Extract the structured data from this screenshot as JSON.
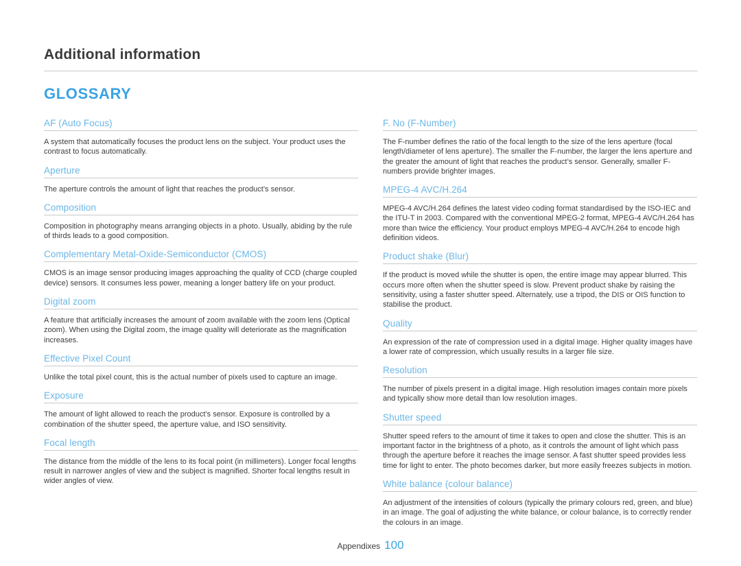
{
  "header": {
    "title": "Additional information"
  },
  "section": {
    "title": "GLOSSARY",
    "accent_color": "#3aa3e3",
    "term_color": "#6ab6e6",
    "rule_color": "#c9c9cb"
  },
  "left_column": [
    {
      "term": "AF (Auto Focus)",
      "desc": "A system that automatically focuses the product lens on the subject. Your product uses the contrast to focus automatically."
    },
    {
      "term": "Aperture",
      "desc": "The aperture controls the amount of light that reaches the product’s sensor."
    },
    {
      "term": "Composition",
      "desc": "Composition in photography means arranging objects in a photo. Usually, abiding by the rule of thirds leads to a good composition."
    },
    {
      "term": "Complementary Metal-Oxide-Semiconductor (CMOS)",
      "desc": "CMOS is an image sensor producing images approaching the quality of CCD (charge coupled device) sensors. It consumes less power, meaning a longer battery life on your product."
    },
    {
      "term": "Digital zoom",
      "desc": "A feature that artificially increases the amount of zoom available with the zoom lens (Optical zoom). When using the Digital zoom, the image quality will deteriorate as the magnification increases."
    },
    {
      "term": "Effective Pixel Count",
      "desc": "Unlike the total pixel count, this is the actual number of pixels used to capture an image."
    },
    {
      "term": "Exposure",
      "desc": "The amount of light allowed to reach the product’s sensor. Exposure is controlled by a combination of the shutter speed, the aperture value, and ISO sensitivity."
    },
    {
      "term": "Focal length",
      "desc": "The distance from the middle of the lens to its focal point (in millimeters). Longer focal lengths result in narrower angles of view and the subject is magnified. Shorter focal lengths result in wider angles of view."
    }
  ],
  "right_column": [
    {
      "term": "F. No (F-Number)",
      "desc": "The F-number defines the ratio of the focal length to the size of the lens aperture (focal length/diameter of lens aperture). The smaller the F-number, the larger the lens aperture and the greater the amount of light that reaches the product’s sensor. Generally, smaller F-numbers provide brighter images."
    },
    {
      "term": "MPEG-4 AVC/H.264",
      "desc": "MPEG-4 AVC/H.264 defines the latest video coding format standardised by the ISO-IEC and the ITU-T in 2003. Compared with the conventional MPEG-2 format, MPEG-4 AVC/H.264 has more than twice the efficiency. Your product employs MPEG-4 AVC/H.264 to encode high definition videos."
    },
    {
      "term": "Product shake (Blur)",
      "desc": "If the product is moved while the shutter is open, the entire image may appear blurred. This occurs more often when the shutter speed is slow. Prevent product shake by raising the sensitivity, using a faster shutter speed. Alternately, use a tripod, the DIS or OIS function to stabilise the product."
    },
    {
      "term": "Quality",
      "desc": "An expression of the rate of compression used in a digital image. Higher quality images have a lower rate of compression, which usually results in a larger file size."
    },
    {
      "term": "Resolution",
      "desc": "The number of pixels present in a digital image. High resolution images contain more pixels and typically show more detail than low resolution images."
    },
    {
      "term": "Shutter speed",
      "desc": "Shutter speed refers to the amount of time it takes to open and close the shutter. This is an important factor in the brightness of a photo, as it controls the amount of light which pass through the aperture before it reaches the image sensor. A fast shutter speed provides less time for light to enter. The photo becomes darker, but more easily freezes subjects in motion."
    },
    {
      "term": "White balance (colour balance)",
      "desc": "An adjustment of the intensities of colours (typically the primary colours red, green, and blue) in an image. The goal of adjusting the white balance, or colour balance, is to correctly render the colours in an image."
    }
  ],
  "footer": {
    "label": "Appendixes",
    "page_number": "100"
  }
}
